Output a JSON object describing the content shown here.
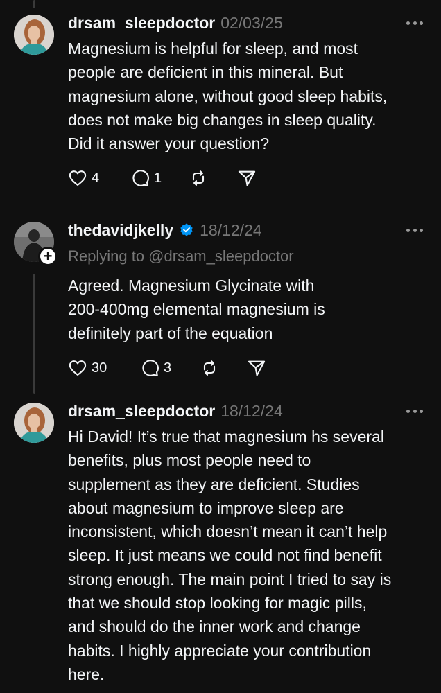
{
  "posts": [
    {
      "username": "drsam_sleepdoctor",
      "timestamp": "02/03/25",
      "body": "Magnesium is helpful for sleep, and most\npeople are deficient in this mineral. But\nmagnesium alone, without good sleep habits,\ndoes not make big changes in sleep quality.\nDid it answer your question?",
      "likes": "4",
      "replies": "1"
    },
    {
      "username": "thedavidjkelly",
      "verified": true,
      "timestamp": "18/12/24",
      "replying_to": "Replying to @drsam_sleepdoctor",
      "body": "Agreed. Magnesium Glycinate with\n200-400mg elemental magnesium is\ndefinitely part of the equation",
      "likes": "30",
      "replies": "3"
    },
    {
      "username": "drsam_sleepdoctor",
      "timestamp": "18/12/24",
      "body": "Hi David! It’s true that magnesium hs several\nbenefits, plus most people need to\nsupplement as they are deficient. Studies\nabout magnesium to improve sleep are\ninconsistent, which doesn’t mean it can’t help\nsleep. It just means we could not find benefit\nstrong enough. The main point I tried to say is\nthat we should stop looking for magic pills,\nand should do the inner work and change\nhabits. I highly appreciate your contribution\nhere."
    }
  ],
  "colors": {
    "background": "#101010",
    "text": "#f3f5f7",
    "muted": "#777777",
    "verified": "#0095f6"
  }
}
